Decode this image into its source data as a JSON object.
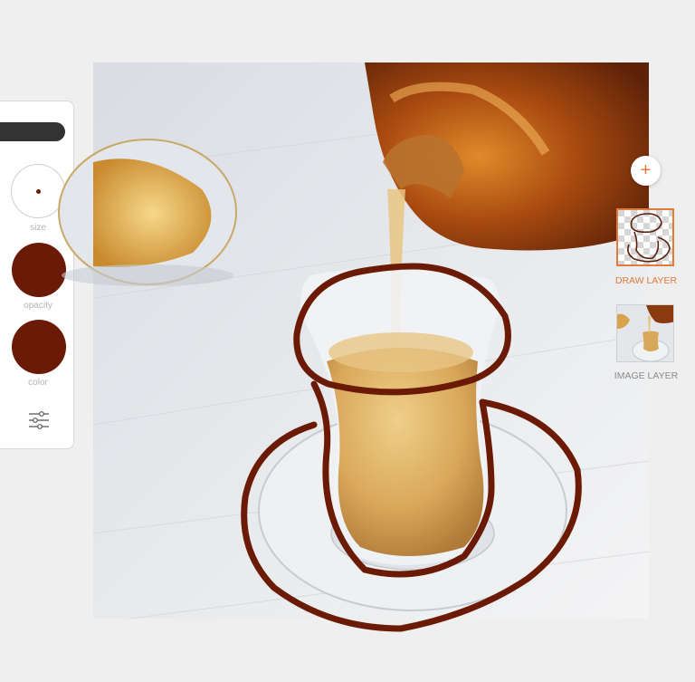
{
  "colors": {
    "brush": "#6b1a05",
    "accent": "#e07b39",
    "muted_label": "#b3b3b3",
    "layer_label_inactive": "#8a8a8a"
  },
  "tools": {
    "size_label": "size",
    "opacity_label": "opacity",
    "color_label": "color",
    "settings_icon": "sliders-icon"
  },
  "layers": {
    "add_icon": "+",
    "items": [
      {
        "label": "DRAW LAYER",
        "active": true
      },
      {
        "label": "IMAGE LAYER",
        "active": false
      }
    ]
  }
}
